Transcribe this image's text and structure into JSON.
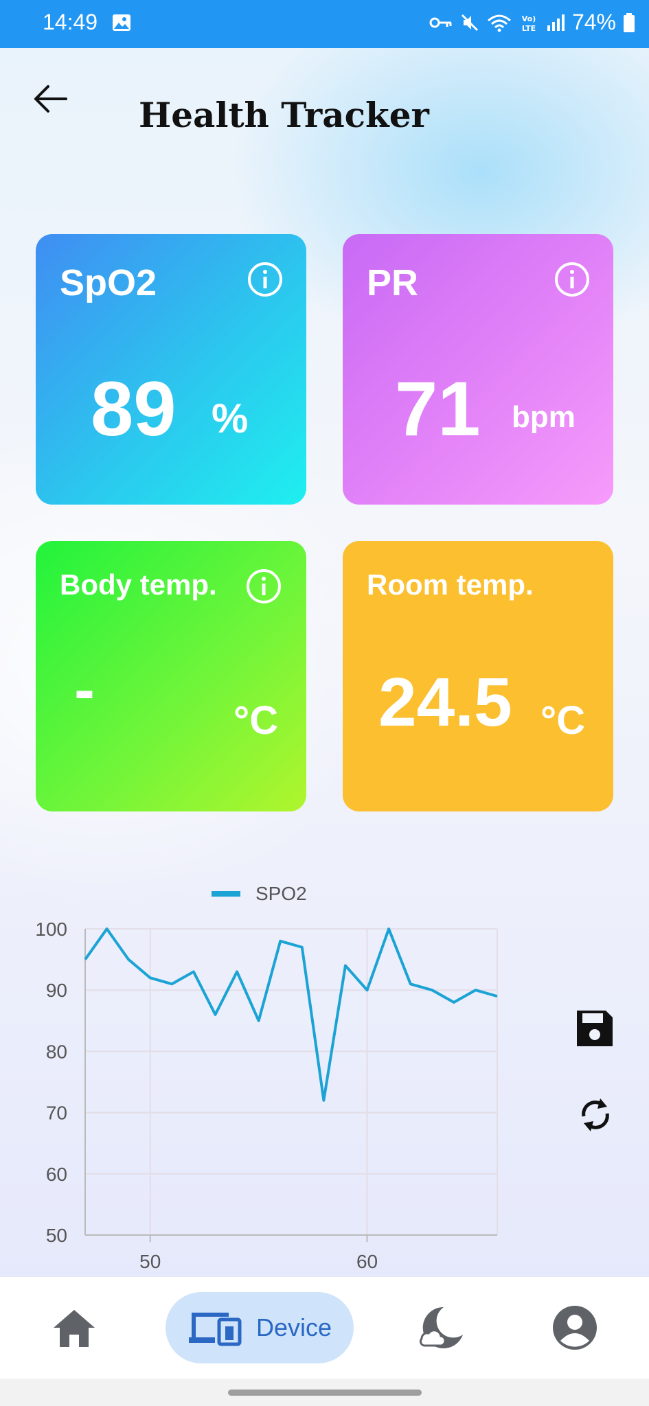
{
  "status_bar": {
    "time": "14:49",
    "battery": "74%"
  },
  "header": {
    "title": "Health Tracker"
  },
  "cards": {
    "spo2": {
      "label": "SpO2",
      "value": "89",
      "unit": "%"
    },
    "pr": {
      "label": "PR",
      "value": "71",
      "unit": "bpm"
    },
    "body_temp": {
      "label": "Body temp.",
      "value": "-",
      "unit": "°C"
    },
    "room_temp": {
      "label": "Room temp.",
      "value": "24.5",
      "unit": "°C"
    }
  },
  "chart_data": {
    "type": "line",
    "legend": "SPO2",
    "x": [
      47,
      48,
      49,
      50,
      51,
      52,
      53,
      54,
      55,
      56,
      57,
      58,
      59,
      60,
      61,
      62,
      63,
      64,
      65,
      66
    ],
    "series": [
      {
        "name": "SPO2",
        "values": [
          95,
          100,
          95,
          92,
          91,
          93,
          86,
          93,
          85,
          98,
          97,
          72,
          94,
          90,
          100,
          91,
          90,
          88,
          90,
          89
        ]
      }
    ],
    "xlim": [
      47,
      66
    ],
    "ylim": [
      50,
      100
    ],
    "xticks": [
      "50",
      "60"
    ],
    "yticks": [
      "100",
      "90",
      "80",
      "70",
      "60",
      "50"
    ],
    "grid": true,
    "colors": {
      "line": "#1aa3d4"
    }
  },
  "actions": {
    "save_icon": "save-icon",
    "refresh_icon": "refresh-icon"
  },
  "nav": {
    "items": [
      {
        "icon": "home-icon"
      },
      {
        "icon": "device-icon",
        "label": "Device"
      },
      {
        "icon": "sleep-icon"
      },
      {
        "icon": "profile-icon"
      }
    ]
  }
}
